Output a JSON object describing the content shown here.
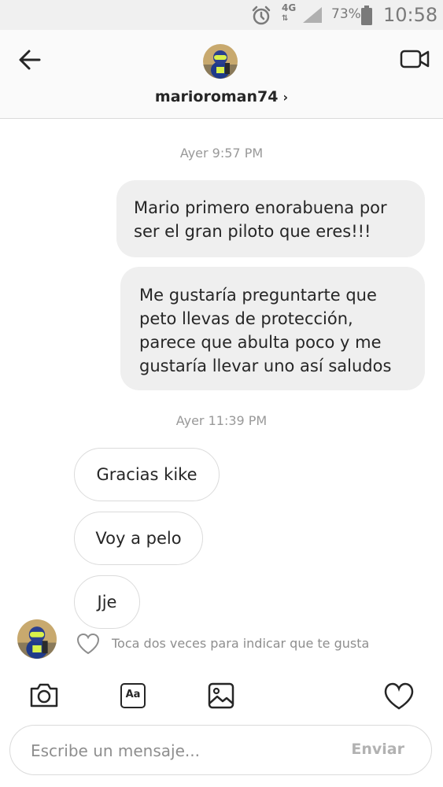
{
  "status_bar": {
    "network": "4G",
    "battery_percent": "73%",
    "time": "10:58",
    "icons": [
      "alarm-icon",
      "signal-icon",
      "battery-icon"
    ]
  },
  "header": {
    "username": "marioroman74",
    "chevron": "›",
    "icons": [
      "back-arrow-icon",
      "video-call-icon"
    ]
  },
  "messages": {
    "timestamp_1": "Ayer 9:57 PM",
    "sent": [
      {
        "line1": "Mario primero enorabuena por",
        "line2": "ser el gran piloto que eres!!!"
      },
      {
        "line1": "Me gustaría preguntarte que",
        "line2": "peto llevas de protección,",
        "line3": "parece que abulta poco y me",
        "line4": "gustaría llevar uno así saludos"
      }
    ],
    "timestamp_2": "Ayer 11:39 PM",
    "received": [
      "Gracias kike",
      "Voy a pelo",
      "Jje"
    ],
    "like_hint": "Toca dos veces para indicar que te gusta"
  },
  "toolbar": {
    "icons": [
      "camera-icon",
      "text-style-icon",
      "gallery-icon",
      "heart-icon"
    ],
    "text_style_label": "Aa"
  },
  "composer": {
    "placeholder": "Escribe un mensaje...",
    "send_label": "Enviar"
  },
  "colors": {
    "accent_blue": "#3897f0",
    "sent_bubble": "#efefef",
    "border": "#dbdbdb",
    "muted_text": "#999999"
  }
}
